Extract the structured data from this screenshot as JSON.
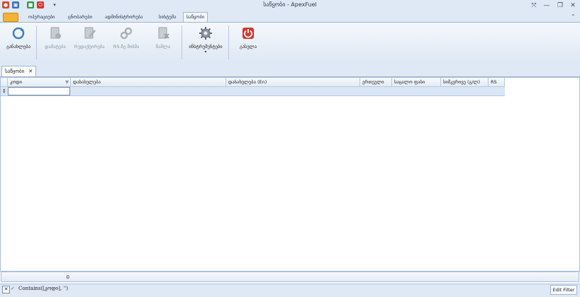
{
  "window": {
    "title": "საწყობი - ApexFuel",
    "controls": [
      "⤧",
      "—",
      "❐",
      "✕"
    ]
  },
  "ribbon_tabs": [
    "ოპერაციები",
    "ცნობარები",
    "ადმინისტრირება",
    "სისტემა",
    "საწყობი"
  ],
  "ribbon_buttons": {
    "refresh": "განახლება",
    "add": "დამატება",
    "edit": "რედაქტირება",
    "rs_bind": "RS-ზე მიბმა",
    "delete": "წაშლა",
    "tools": "ინსტრუმენტები",
    "exit": "გასვლა"
  },
  "doc_tab": {
    "label": "საწყობი",
    "close": "✕"
  },
  "grid": {
    "columns": [
      "კოდი",
      "დასახელება",
      "დასახელება (En)",
      "ერთეული",
      "საცალო ფასი",
      "სიმკვრივე (გ/ლ)",
      "RS"
    ],
    "filter_row_indicator": "↕",
    "footer_count": "0"
  },
  "filter_bar": {
    "close": "✕",
    "check": "✓",
    "text": "Contains([კოდი], '')",
    "edit_button": "Edit Filter"
  },
  "colors": {
    "accent": "#dfe9f5",
    "exit_red": "#d9342b",
    "app_orange": "#f3b233"
  }
}
